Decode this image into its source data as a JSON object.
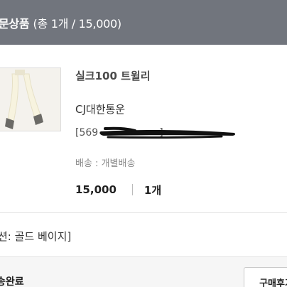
{
  "header": {
    "title": "문상품",
    "count": "(총 1개 / 15,000)"
  },
  "product": {
    "name": "실크100 트윌리",
    "courier": "CJ대한통운",
    "tracking_visible": "[569",
    "tracking_tail": "]",
    "shipping": "배송 : 개별배송",
    "price": "15,000",
    "quantity": "1개"
  },
  "option": {
    "text": "션: 골드 베이지]"
  },
  "footer": {
    "status": "송완료",
    "review_button": "구매후기"
  },
  "colors": {
    "header_bg": "#71757d",
    "redaction": "#111111"
  }
}
